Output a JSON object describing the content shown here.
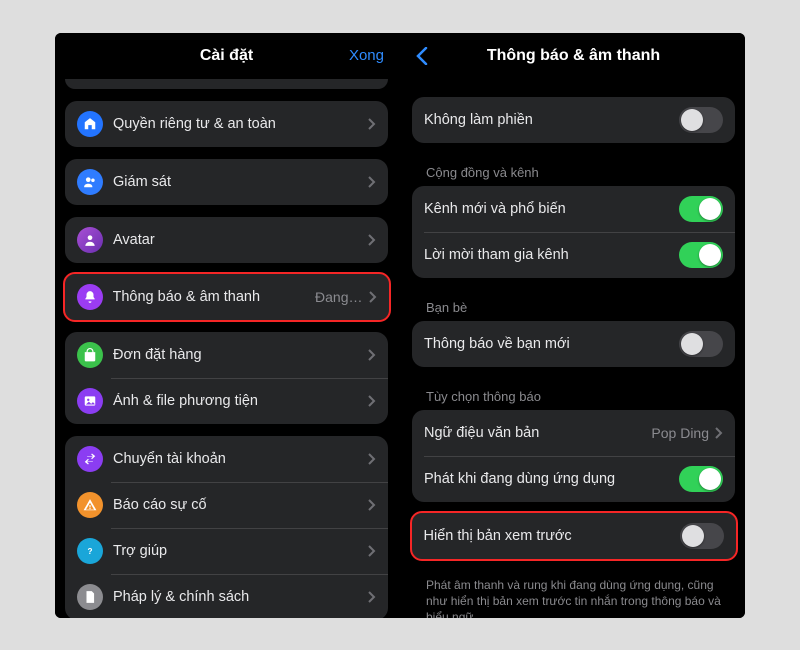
{
  "left": {
    "title": "Cài đặt",
    "done": "Xong",
    "rows": {
      "privacy": "Quyền riêng tư & an toàn",
      "supervision": "Giám sát",
      "avatar": "Avatar",
      "notifications": "Thông báo & âm thanh",
      "notifications_value": "Đang…",
      "orders": "Đơn đặt hàng",
      "media": "Ảnh & file phương tiện",
      "switch": "Chuyển tài khoản",
      "report": "Báo cáo sự cố",
      "help": "Trợ giúp",
      "legal": "Pháp lý & chính sách"
    }
  },
  "right": {
    "title": "Thông báo & âm thanh",
    "rows": {
      "dnd": "Không làm phiền",
      "community_header": "Cộng đồng và kênh",
      "channel_new": "Kênh mới và phổ biến",
      "channel_invite": "Lời mời tham gia kênh",
      "friends_header": "Bạn bè",
      "new_friend": "Thông báo về bạn mới",
      "options_header": "Tùy chọn thông báo",
      "text_tone": "Ngữ điệu văn bản",
      "text_tone_value": "Pop Ding",
      "play_in_app": "Phát khi đang dùng ứng dụng",
      "show_preview": "Hiển thị bản xem trước",
      "footer": "Phát âm thanh và rung khi đang dùng ứng dụng, cũng như hiển thị bản xem trước tin nhắn trong thông báo và biểu ngữ."
    },
    "toggles": {
      "dnd": false,
      "channel_new": true,
      "channel_invite": true,
      "new_friend": false,
      "play_in_app": true,
      "show_preview": false
    }
  },
  "colors": {
    "blue": "#2374ff",
    "teal": "#1aa6d9",
    "purple": "#9b3cf3",
    "green": "#3bc24b",
    "violet": "#8b3df2",
    "orange": "#f2922c",
    "grey": "#8c8c90",
    "people": "#2f7cff"
  }
}
